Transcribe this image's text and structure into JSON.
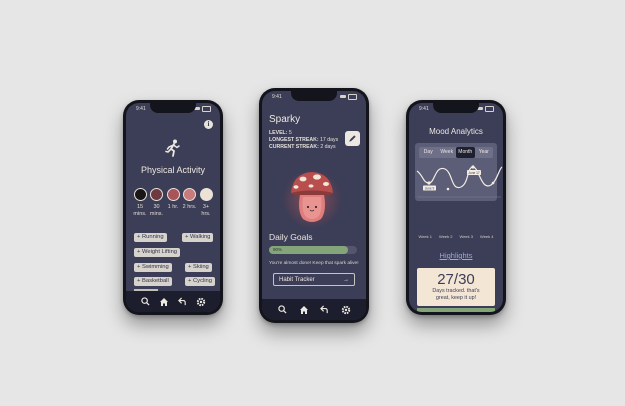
{
  "status_time": "9:41",
  "physical": {
    "title": "Physical Activity",
    "swatches": [
      {
        "color": "#1a1616",
        "label": "15 mins."
      },
      {
        "color": "#6e3a40",
        "label": "30 mins."
      },
      {
        "color": "#a85458",
        "label": "1 hr."
      },
      {
        "color": "#c87b7b",
        "label": "2 hrs."
      },
      {
        "color": "#ede1d3",
        "label": "3+ hrs."
      }
    ],
    "tags": [
      "+ Running",
      "+ Walking",
      "+ Weight Lifting",
      "+ Swimming",
      "+ Skiing",
      "+ Basketball",
      "+ Cycling"
    ]
  },
  "sparky": {
    "title": "Sparky",
    "level_label": "LEVEL:",
    "level_value": "5",
    "longest_label": "LONGEST STREAK:",
    "longest_value": "17 days",
    "current_label": "CURRENT STREAK:",
    "current_value": "2 days",
    "goals_title": "Daily Goals",
    "progress_label": "90%",
    "progress": 0.9,
    "message": "You're almost done! Keep that spark alive!",
    "habit_button": "Habit Tracker",
    "arrow": "→"
  },
  "mood": {
    "title": "Mood Analytics",
    "tabs": [
      "Day",
      "Week",
      "Month",
      "Year"
    ],
    "active_tab": "Month",
    "points": [
      {
        "label": "June 9"
      },
      {
        "label": "June 17"
      }
    ],
    "x_labels": [
      "Week 1",
      "Week 2",
      "Week 3",
      "Week 4"
    ],
    "highlights_title": "Highlights",
    "big_number": "27/30",
    "line1": "Days tracked. that's",
    "line2": "great, keep it up!"
  }
}
